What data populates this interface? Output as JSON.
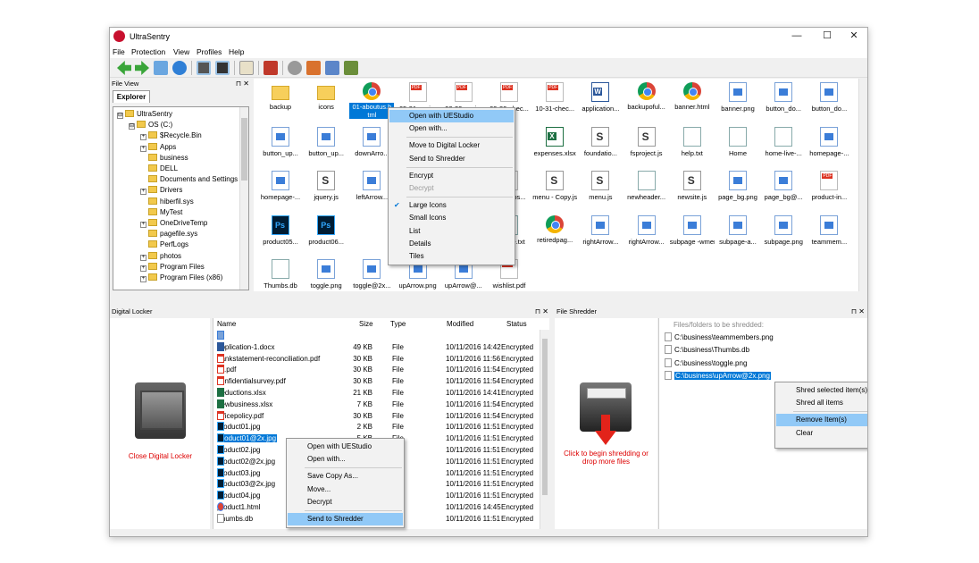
{
  "app": {
    "title": "UltraSentry"
  },
  "window_controls": {
    "minimize": "—",
    "maximize": "☐",
    "close": "✕"
  },
  "menu": [
    "File",
    "Protection",
    "View",
    "Profiles",
    "Help"
  ],
  "toolbar_icons": [
    "back-icon",
    "forward-icon",
    "folder-up-icon",
    "refresh-icon",
    "digital-locker-icon",
    "drive-icon",
    "properties-icon",
    "shredder-icon",
    "settings-icon",
    "encrypt-icon",
    "decrypt-icon",
    "shred-icon"
  ],
  "file_view": {
    "header": "File View",
    "tab": "Explorer",
    "pin": "⊓ ✕",
    "tree": [
      {
        "label": "UltraSentry",
        "level": 0,
        "expander": "⊟"
      },
      {
        "label": "OS (C:)",
        "level": 1,
        "expander": "⊟"
      },
      {
        "label": "$Recycle.Bin",
        "level": 2,
        "expander": "+"
      },
      {
        "label": "Apps",
        "level": 2,
        "expander": "+"
      },
      {
        "label": "business",
        "level": 2,
        "expander": ""
      },
      {
        "label": "DELL",
        "level": 2,
        "expander": ""
      },
      {
        "label": "Documents and Settings",
        "level": 2,
        "expander": ""
      },
      {
        "label": "Drivers",
        "level": 2,
        "expander": "+"
      },
      {
        "label": "hiberfil.sys",
        "level": 2,
        "expander": ""
      },
      {
        "label": "MyTest",
        "level": 2,
        "expander": ""
      },
      {
        "label": "OneDriveTemp",
        "level": 2,
        "expander": "+"
      },
      {
        "label": "pagefile.sys",
        "level": 2,
        "expander": ""
      },
      {
        "label": "PerfLogs",
        "level": 2,
        "expander": ""
      },
      {
        "label": "photos",
        "level": 2,
        "expander": "+"
      },
      {
        "label": "Program Files",
        "level": 2,
        "expander": "+"
      },
      {
        "label": "Program Files (x86)",
        "level": 2,
        "expander": "+"
      }
    ],
    "items": [
      {
        "label": "backup",
        "type": "folder"
      },
      {
        "label": "icons",
        "type": "folder"
      },
      {
        "label": "01-aboutus.h tml",
        "type": "chrome",
        "selected": true
      },
      {
        "label": "05-31-savi...",
        "type": "pdf"
      },
      {
        "label": "08-30-savi...",
        "type": "pdf"
      },
      {
        "label": "09-30-chec...",
        "type": "pdf"
      },
      {
        "label": "10-31-chec...",
        "type": "pdf"
      },
      {
        "label": "application...",
        "type": "doc"
      },
      {
        "label": "backupoful...",
        "type": "chrome"
      },
      {
        "label": "banner.html",
        "type": "chrome"
      },
      {
        "label": "banner.png",
        "type": "img"
      },
      {
        "label": "button_do...",
        "type": "img"
      },
      {
        "label": "button_do...",
        "type": "img"
      },
      {
        "label": "button_up...",
        "type": "img"
      },
      {
        "label": "button_up...",
        "type": "img"
      },
      {
        "label": "downArro...",
        "type": "img"
      },
      {
        "label": "",
        "type": "none"
      },
      {
        "label": "",
        "type": "none"
      },
      {
        "label": "",
        "type": "none"
      },
      {
        "label": "expenses.xlsx",
        "type": "xls"
      },
      {
        "label": "foundatio...",
        "type": "js"
      },
      {
        "label": "fsproject.js",
        "type": "js"
      },
      {
        "label": "help.txt",
        "type": "file"
      },
      {
        "label": "Home",
        "type": "file"
      },
      {
        "label": "home-live-...",
        "type": "file"
      },
      {
        "label": "homepage-...",
        "type": "img"
      },
      {
        "label": "homepage-...",
        "type": "img"
      },
      {
        "label": "jquery.js",
        "type": "js"
      },
      {
        "label": "leftArrow...",
        "type": "img"
      },
      {
        "label": "",
        "type": "none"
      },
      {
        "label": "...gp...",
        "type": "none"
      },
      {
        "label": "memotos...",
        "type": "pdf"
      },
      {
        "label": "menu - Copy.js",
        "type": "js"
      },
      {
        "label": "menu.js",
        "type": "js"
      },
      {
        "label": "newheader...",
        "type": "file"
      },
      {
        "label": "newsite.js",
        "type": "js"
      },
      {
        "label": "page_bg.png",
        "type": "img"
      },
      {
        "label": "page_bg@...",
        "type": "img"
      },
      {
        "label": "product-in...",
        "type": "pdf"
      },
      {
        "label": "product05...",
        "type": "ps"
      },
      {
        "label": "product06...",
        "type": "ps"
      },
      {
        "label": "",
        "type": "none"
      },
      {
        "label": "",
        "type": "none"
      },
      {
        "label": "...07...",
        "type": "none"
      },
      {
        "label": "readme.txt",
        "type": "file"
      },
      {
        "label": "retiredpag...",
        "type": "chrome"
      },
      {
        "label": "rightArrow...",
        "type": "img"
      },
      {
        "label": "rightArrow...",
        "type": "img"
      },
      {
        "label": "subpage -wmenu.png",
        "type": "img"
      },
      {
        "label": "subpage-a...",
        "type": "img"
      },
      {
        "label": "subpage.png",
        "type": "img"
      },
      {
        "label": "teammem...",
        "type": "img"
      },
      {
        "label": "Thumbs.db",
        "type": "file"
      },
      {
        "label": "toggle.png",
        "type": "img"
      },
      {
        "label": "toggle@2x...",
        "type": "img"
      },
      {
        "label": "upArrow.png",
        "type": "img"
      },
      {
        "label": "upArrow@...",
        "type": "img"
      },
      {
        "label": "wishlist.pdf",
        "type": "pdf"
      }
    ],
    "context_menu": [
      {
        "label": "Open with UEStudio",
        "state": "selected"
      },
      {
        "label": "Open with...",
        "state": ""
      },
      {
        "label": "sep"
      },
      {
        "label": "Move to Digital Locker",
        "state": ""
      },
      {
        "label": "Send to Shredder",
        "state": ""
      },
      {
        "label": "sep"
      },
      {
        "label": "Encrypt",
        "state": ""
      },
      {
        "label": "Decrypt",
        "state": "disabled"
      },
      {
        "label": "sep"
      },
      {
        "label": "Large Icons",
        "state": "checked"
      },
      {
        "label": "Small Icons",
        "state": ""
      },
      {
        "label": "List",
        "state": ""
      },
      {
        "label": "Details",
        "state": ""
      },
      {
        "label": "Tiles",
        "state": ""
      }
    ]
  },
  "digital_locker": {
    "header": "Digital Locker",
    "pin": "⊓ ✕",
    "close_label": "Close Digital Locker",
    "columns": [
      "Name",
      "Size",
      "Type",
      "Modified",
      "Status"
    ],
    "rows": [
      {
        "name": "..",
        "size": "",
        "type": "",
        "modified": "",
        "status": "",
        "icon": "up"
      },
      {
        "name": "application-1.docx",
        "size": "49 KB",
        "type": "File",
        "modified": "10/11/2016 14:42",
        "status": "Encrypted",
        "icon": "doc"
      },
      {
        "name": "bankstatement-reconciliation.pdf",
        "size": "30 KB",
        "type": "File",
        "modified": "10/11/2016 11:56",
        "status": "Encrypted",
        "icon": "pdf"
      },
      {
        "name": "cc.pdf",
        "size": "30 KB",
        "type": "File",
        "modified": "10/11/2016 11:54",
        "status": "Encrypted",
        "icon": "pdf"
      },
      {
        "name": "confidentialsurvey.pdf",
        "size": "30 KB",
        "type": "File",
        "modified": "10/11/2016 11:54",
        "status": "Encrypted",
        "icon": "pdf"
      },
      {
        "name": "deductions.xlsx",
        "size": "21 KB",
        "type": "File",
        "modified": "10/11/2016 14:41",
        "status": "Encrypted",
        "icon": "xls"
      },
      {
        "name": "newbusiness.xlsx",
        "size": "7 KB",
        "type": "File",
        "modified": "10/11/2016 11:54",
        "status": "Encrypted",
        "icon": "xls"
      },
      {
        "name": "officepolicy.pdf",
        "size": "30 KB",
        "type": "File",
        "modified": "10/11/2016 11:54",
        "status": "Encrypted",
        "icon": "pdf"
      },
      {
        "name": "product01.jpg",
        "size": "2 KB",
        "type": "File",
        "modified": "10/11/2016 11:51",
        "status": "Encrypted",
        "icon": "ps"
      },
      {
        "name": "product01@2x.jpg",
        "size": "5 KB",
        "type": "File",
        "modified": "10/11/2016 11:51",
        "status": "Encrypted",
        "icon": "ps",
        "selected": true
      },
      {
        "name": "product02.jpg",
        "size": "",
        "type": "",
        "modified": "10/11/2016 11:51",
        "status": "Encrypted",
        "icon": "ps"
      },
      {
        "name": "product02@2x.jpg",
        "size": "",
        "type": "",
        "modified": "10/11/2016 11:51",
        "status": "Encrypted",
        "icon": "ps"
      },
      {
        "name": "product03.jpg",
        "size": "",
        "type": "",
        "modified": "10/11/2016 11:51",
        "status": "Encrypted",
        "icon": "ps"
      },
      {
        "name": "product03@2x.jpg",
        "size": "",
        "type": "",
        "modified": "10/11/2016 11:51",
        "status": "Encrypted",
        "icon": "ps"
      },
      {
        "name": "product04.jpg",
        "size": "",
        "type": "",
        "modified": "10/11/2016 11:51",
        "status": "Encrypted",
        "icon": "ps"
      },
      {
        "name": "product1.html",
        "size": "",
        "type": "",
        "modified": "10/11/2016 14:45",
        "status": "Encrypted",
        "icon": "chrome"
      },
      {
        "name": "Thumbs.db",
        "size": "",
        "type": "",
        "modified": "10/11/2016 11:51",
        "status": "Encrypted",
        "icon": "file"
      }
    ],
    "context_menu": [
      {
        "label": "Open with UEStudio",
        "state": ""
      },
      {
        "label": "Open with...",
        "state": ""
      },
      {
        "label": "sep"
      },
      {
        "label": "Save Copy As...",
        "state": ""
      },
      {
        "label": "Move...",
        "state": ""
      },
      {
        "label": "Decrypt",
        "state": ""
      },
      {
        "label": "sep"
      },
      {
        "label": "Send to Shredder",
        "state": "selected"
      }
    ]
  },
  "file_shredder": {
    "header": "File Shredder",
    "pin": "⊓ ✕",
    "hint": "Click to begin shredding or drop more files",
    "list_title": "Files/folders to be shredded:",
    "items": [
      {
        "label": "C:\\business\\teammembers.png"
      },
      {
        "label": "C:\\business\\Thumbs.db"
      },
      {
        "label": "C:\\business\\toggle.png"
      },
      {
        "label": "C:\\business\\upArrow@2x.png",
        "selected": true
      }
    ],
    "context_menu": [
      {
        "label": "Shred selected item(s)",
        "state": ""
      },
      {
        "label": "Shred all items",
        "state": ""
      },
      {
        "label": "sep"
      },
      {
        "label": "Remove Item(s)",
        "state": "selected"
      },
      {
        "label": "Clear",
        "state": ""
      }
    ]
  },
  "colors": {
    "selection": "#0078d7",
    "menu_highlight": "#91c9f7",
    "accent_red": "#dd0000"
  }
}
